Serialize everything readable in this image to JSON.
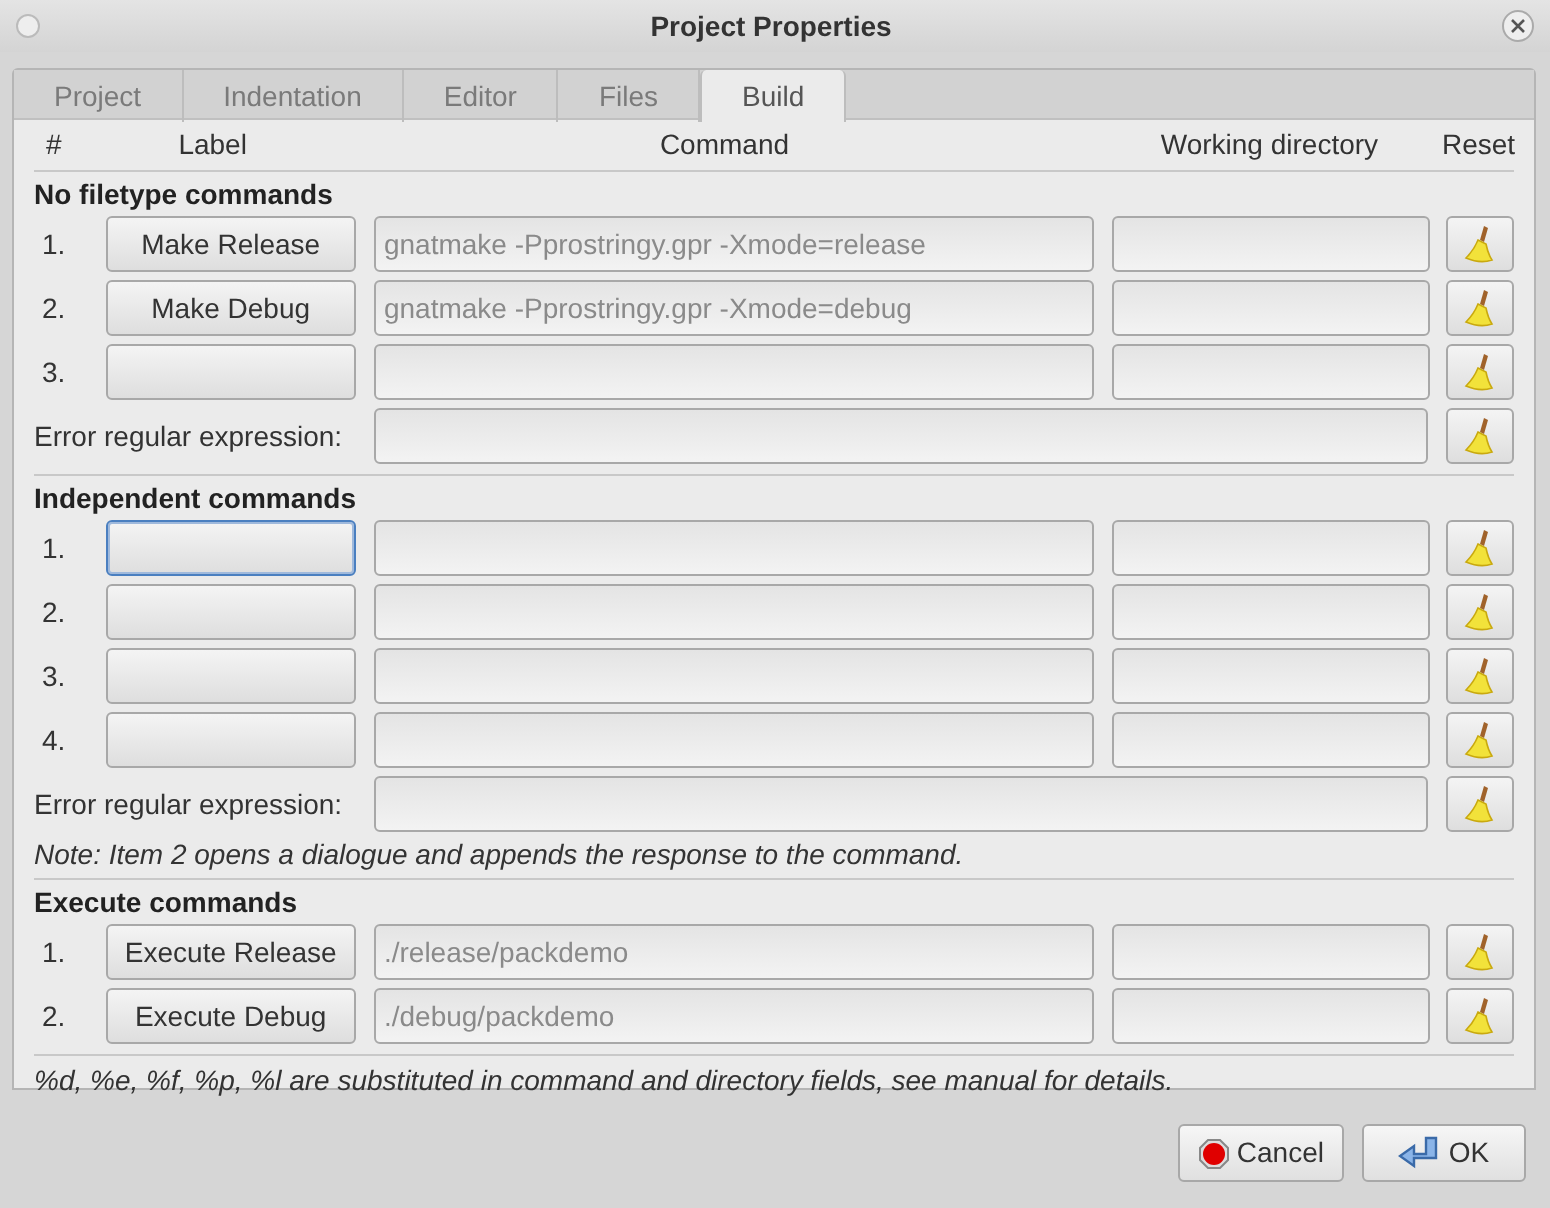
{
  "window": {
    "title": "Project Properties"
  },
  "tabs": [
    {
      "label": "Project",
      "selected": false
    },
    {
      "label": "Indentation",
      "selected": false
    },
    {
      "label": "Editor",
      "selected": false
    },
    {
      "label": "Files",
      "selected": false
    },
    {
      "label": "Build",
      "selected": true
    }
  ],
  "columns": [
    "#",
    "Label",
    "Command",
    "Working directory",
    "Reset"
  ],
  "sections": [
    {
      "title": "No filetype commands",
      "rows": [
        {
          "number": "1.",
          "label": "Make Release",
          "command": "gnatmake -Pprostringy.gpr -Xmode=release",
          "focused": false
        },
        {
          "number": "2.",
          "label": "Make Debug",
          "command": "gnatmake -Pprostringy.gpr -Xmode=debug",
          "focused": false
        },
        {
          "number": "3.",
          "focused": false
        }
      ],
      "error_label": "Error regular expression:"
    },
    {
      "title": "Independent commands",
      "rows": [
        {
          "number": "1.",
          "focused": true
        },
        {
          "number": "2.",
          "focused": false
        },
        {
          "number": "3.",
          "focused": false
        },
        {
          "number": "4.",
          "focused": false
        }
      ],
      "error_label": "Error regular expression:",
      "note": "Note: Item 2 opens a dialogue and appends the response to the command."
    },
    {
      "title": "Execute commands",
      "rows": [
        {
          "number": "1.",
          "label": "Execute Release",
          "command": "./release/packdemo",
          "focused": false
        },
        {
          "number": "2.",
          "label": "Execute Debug",
          "command": "./debug/packdemo",
          "focused": false
        }
      ]
    }
  ],
  "footnote": "%d, %e, %f, %p, %l are substituted in command and directory fields, see manual for details.",
  "buttons": [
    {
      "kind": "cancel",
      "label": "Cancel"
    },
    {
      "kind": "ok",
      "label": "OK"
    }
  ]
}
